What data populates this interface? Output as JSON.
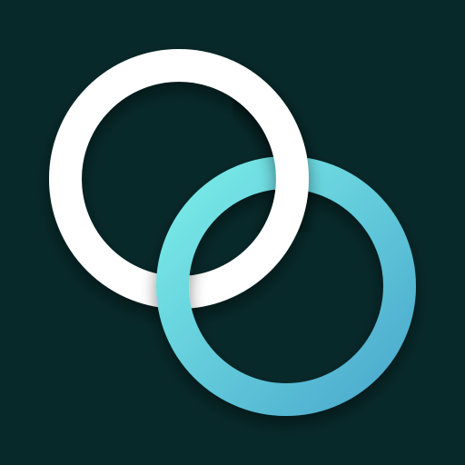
{
  "icon": {
    "name": "interlocking-rings-icon",
    "colors": {
      "background": "#08292A",
      "ring_white": "#FFFFFF",
      "ring_teal_start": "#7AECE8",
      "ring_teal_end": "#4BA9CD",
      "shadow": "#000000"
    }
  }
}
